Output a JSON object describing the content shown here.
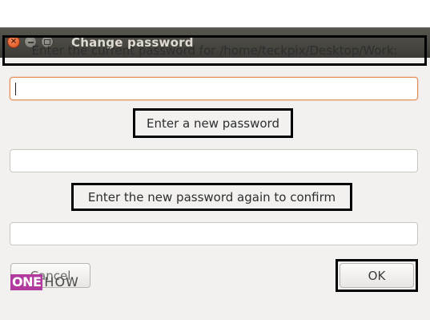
{
  "window": {
    "title": "Change password",
    "controls": {
      "close_icon": "×",
      "minimize_icon": "minimize-icon",
      "maximize_icon": "maximize-icon"
    }
  },
  "form": {
    "current_password_label": "Enter the current password for /home/teckpix/Desktop/Work:",
    "current_password_value": "",
    "new_password_label": "Enter a new password",
    "new_password_value": "",
    "confirm_password_label": "Enter the new password again to confirm",
    "confirm_password_value": ""
  },
  "buttons": {
    "cancel_label": "Cancel",
    "ok_label": "OK"
  },
  "watermark": {
    "left": "ONE",
    "right": "HOW"
  },
  "colors": {
    "titlebar": "#3c3b37",
    "close_button": "#dc4d1b",
    "focus_border": "#e0915a",
    "highlight_border": "#000000",
    "watermark_accent": "#b23a9e"
  }
}
